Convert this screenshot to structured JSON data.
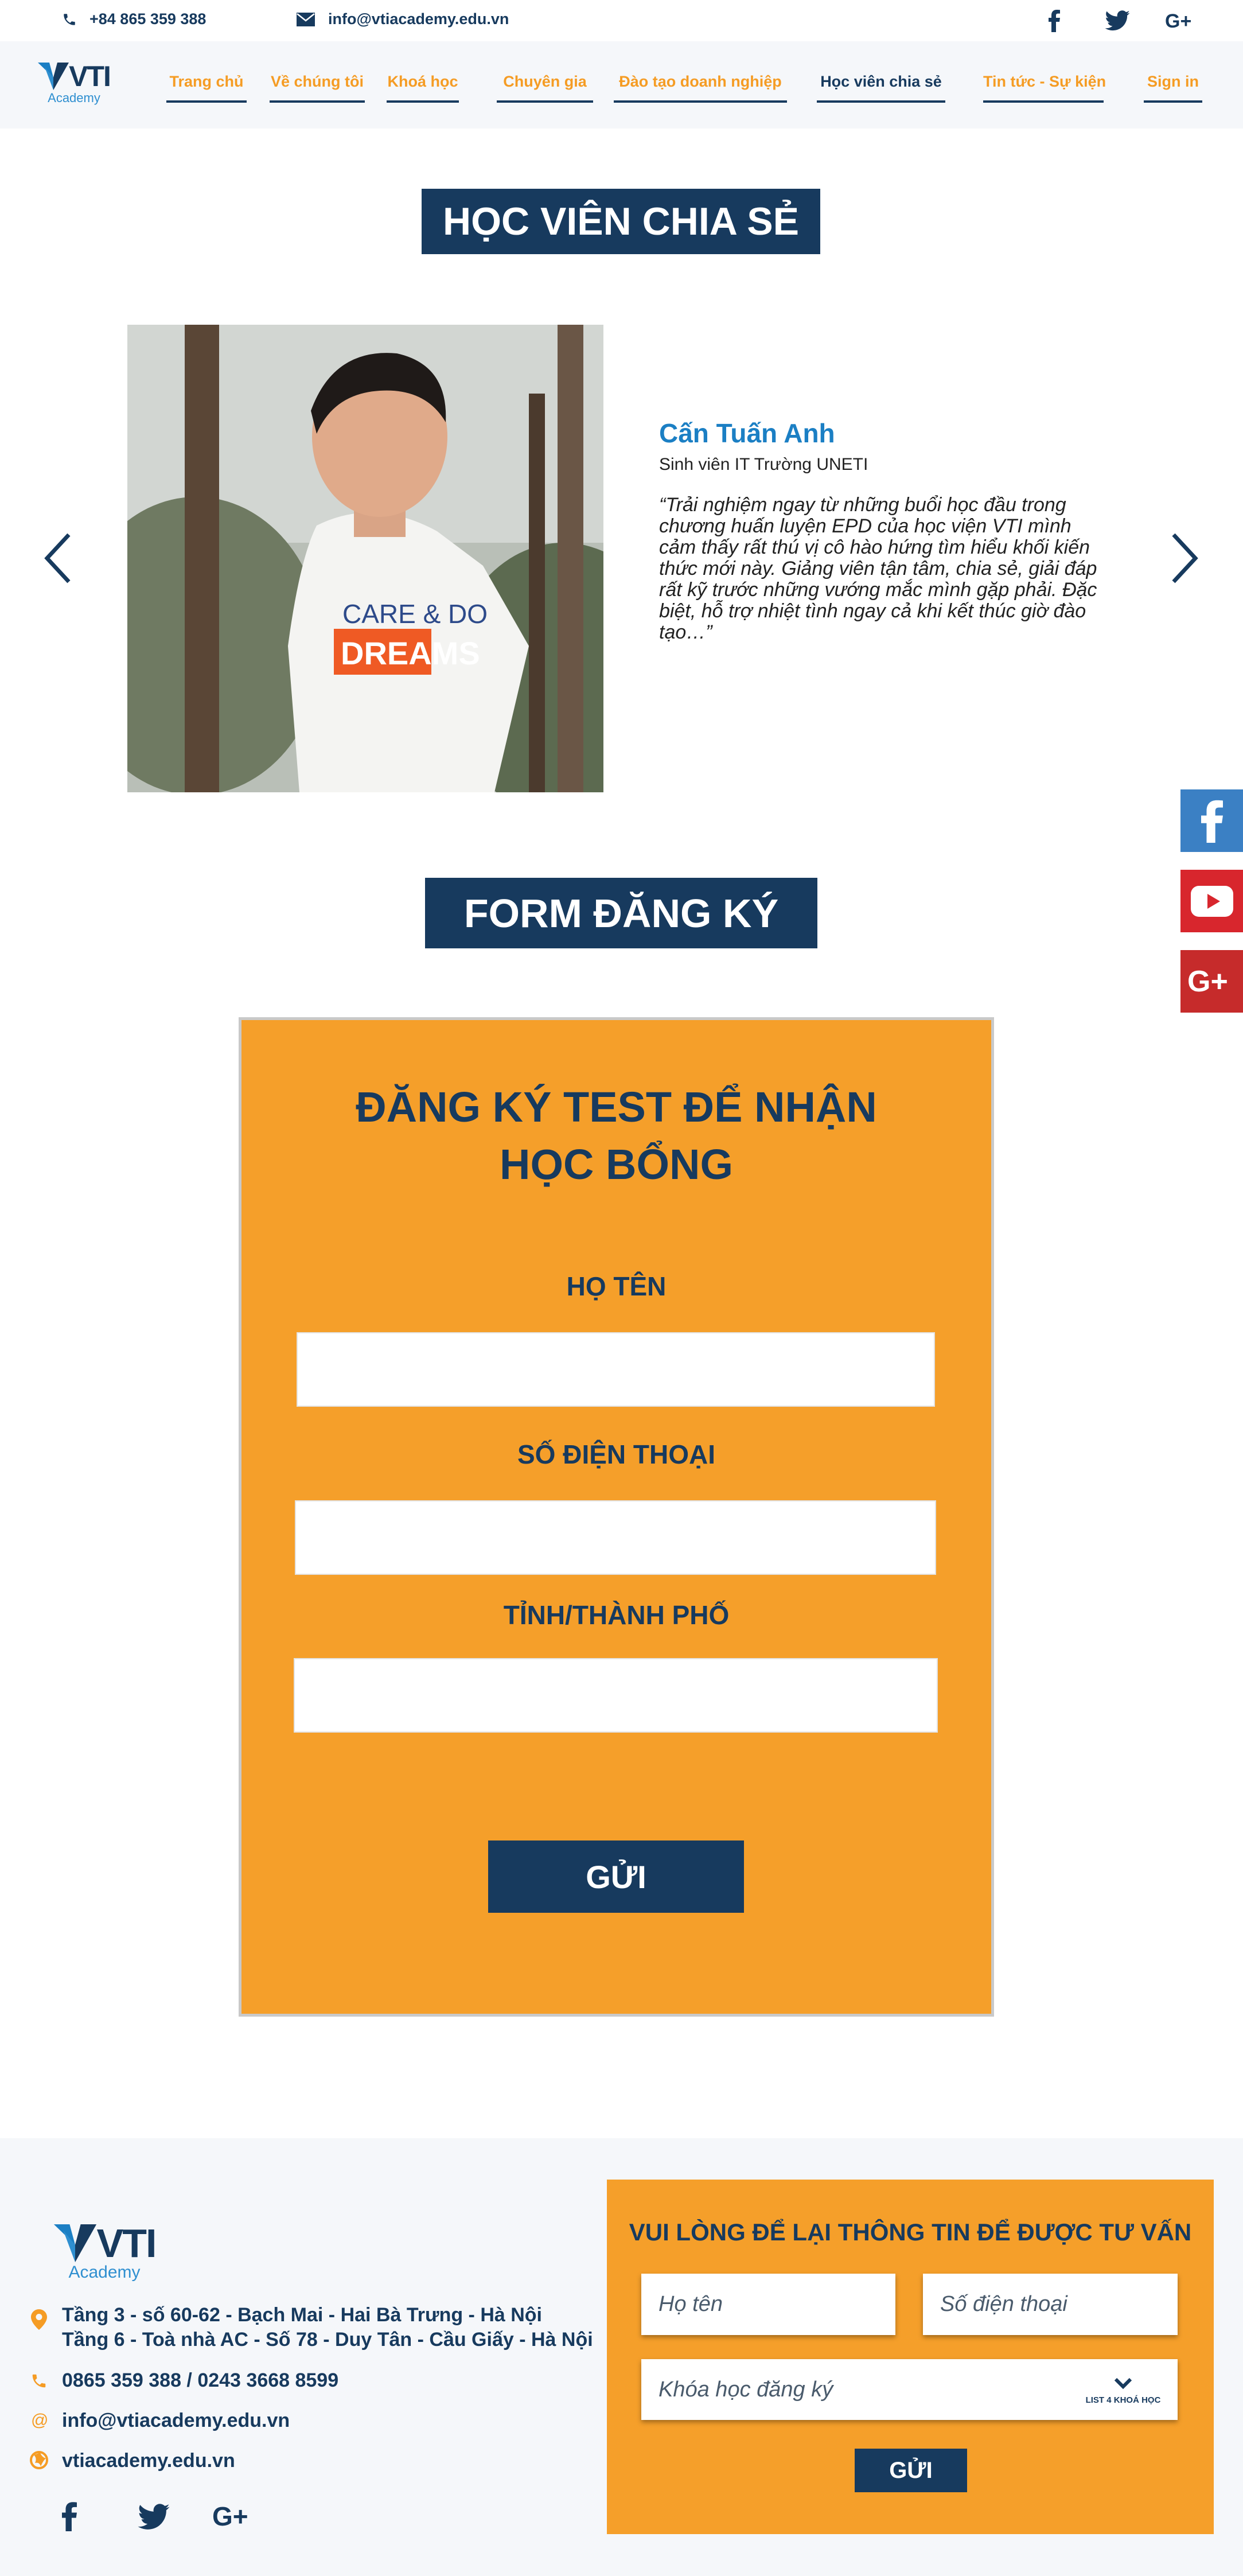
{
  "contact_bar": {
    "phone": "+84 865 359 388",
    "email": "info@vtiacademy.edu.vn",
    "social": [
      "facebook-icon",
      "twitter-icon",
      "google-plus-icon"
    ]
  },
  "brand": {
    "name": "VTI",
    "subtitle": "Academy",
    "colors": {
      "navy": "#173a5e",
      "orange": "#f59c24",
      "blue": "#1b7fc4"
    }
  },
  "nav": {
    "items": [
      {
        "label": "Trang chủ"
      },
      {
        "label": "Về chúng tôi"
      },
      {
        "label": "Khoá học"
      },
      {
        "label": "Chuyên gia"
      },
      {
        "label": "Đào tạo doanh nghiệp"
      },
      {
        "label": "Học viên chia sẻ",
        "active": true
      },
      {
        "label": "Tin tức - Sự kiện"
      },
      {
        "label": "Sign in"
      }
    ]
  },
  "testimonials": {
    "title": "HỌC VIÊN CHIA SẺ",
    "name": "Cấn Tuấn Anh",
    "role": "Sinh viên IT Trường UNETI",
    "quote": "“Trải nghiệm ngay từ những buổi học đầu trong chương huấn luyện EPD của học viện VTI mình cảm thấy rất thú vị cô hào hứng tìm hiểu khối kiến thức mới này. Giảng viên tận tâm, chia sẻ, giải đáp rất kỹ trước những vướng mắc mình gặp phải. Đặc biệt, hỗ trợ nhiệt tình ngay cả khi kết thúc giờ đào tạo…”",
    "photo_shirt_text": {
      "line1": "CARE & DO",
      "line2": "DREAMS"
    }
  },
  "floating_social": [
    "facebook-icon",
    "youtube-icon",
    "google-plus-icon"
  ],
  "register": {
    "section_title": "FORM ĐĂNG KÝ",
    "heading_line1": "ĐĂNG KÝ TEST ĐỂ NHẬN",
    "heading_line2": "HỌC BỔNG",
    "fields": [
      {
        "label": "HỌ TÊN",
        "value": ""
      },
      {
        "label": "SỐ ĐIỆN THOẠI",
        "value": ""
      },
      {
        "label": "TỈNH/THÀNH PHỐ",
        "value": ""
      }
    ],
    "submit_label": "GỬI"
  },
  "footer": {
    "address_line1": "Tầng 3 - số 60-62 - Bạch Mai - Hai Bà Trưng - Hà Nội",
    "address_line2": "Tầng 6 - Toà nhà AC - Số 78 - Duy Tân - Cầu Giấy - Hà Nội",
    "phones": "0865 359 388 / 0243 3668 8599",
    "email": "info@vtiacademy.edu.vn",
    "website": "vtiacademy.edu.vn",
    "consult": {
      "title": "VUI LÒNG ĐỂ LẠI THÔNG TIN ĐỂ ĐƯỢC TƯ VẤN",
      "name_placeholder": "Họ tên",
      "phone_placeholder": "Số điện thoại",
      "course_placeholder": "Khóa học đăng ký",
      "course_hint": "LIST 4 KHOÁ HỌC",
      "submit_label": "GỬI"
    }
  }
}
